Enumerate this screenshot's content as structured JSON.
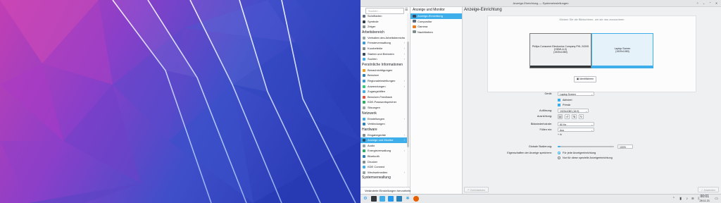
{
  "window": {
    "title": "Anzeige-Einrichtung — Systemeinstellungen",
    "buttons": {
      "help": "?",
      "minimize": "⌄",
      "maximize": "⌃",
      "close": "✕"
    }
  },
  "sidebar": {
    "search_placeholder": "Suchen ...",
    "menu_icon": "hamburger-icon",
    "groups": [
      {
        "items": [
          {
            "label": "Schriftarten",
            "icon_color": "#5d6d7e",
            "chevron": false
          },
          {
            "label": "Symbole",
            "icon_color": "#2c3e50",
            "chevron": false
          },
          {
            "label": "Zeiger",
            "icon_color": "#7f8c8d",
            "chevron": false
          }
        ]
      },
      {
        "heading": "Arbeitsbereich",
        "items": [
          {
            "label": "Verhalten des Arbeitsbereichs",
            "icon_color": "#95a5a6",
            "chevron": true
          },
          {
            "label": "Fensterverwaltung",
            "icon_color": "#3498db",
            "chevron": true
          },
          {
            "label": "Kurzbefehle",
            "icon_color": "#7f8c8d",
            "chevron": true
          },
          {
            "label": "Starten und Beenden",
            "icon_color": "#34495e",
            "chevron": true
          },
          {
            "label": "Suchen",
            "icon_color": "#3daee9",
            "chevron": true
          }
        ]
      },
      {
        "heading": "Persönliche Informationen",
        "items": [
          {
            "label": "Benachrichtigungen",
            "icon_color": "#f39c12",
            "chevron": false
          },
          {
            "label": "Benutzer",
            "icon_color": "#2980b9",
            "chevron": false
          },
          {
            "label": "Regionaleinstellungen",
            "icon_color": "#3498db",
            "chevron": true
          },
          {
            "label": "Anwendungen",
            "icon_color": "#2ecc71",
            "chevron": true
          },
          {
            "label": "Zugangshilfen",
            "icon_color": "#3daee9",
            "chevron": false
          },
          {
            "label": "Benutzer-Feedback",
            "icon_color": "#e74c3c",
            "chevron": false
          },
          {
            "label": "KDE-Passwortspeicher",
            "icon_color": "#27ae60",
            "chevron": false
          },
          {
            "label": "Sitzungen",
            "icon_color": "#95a5a6",
            "chevron": false
          }
        ]
      },
      {
        "heading": "Netzwerk",
        "items": [
          {
            "label": "Einstellungen",
            "icon_color": "#3daee9",
            "chevron": true
          },
          {
            "label": "Verbindungen",
            "icon_color": "#2980b9",
            "chevron": false
          }
        ]
      },
      {
        "heading": "Hardware",
        "items": [
          {
            "label": "Eingabegeräte",
            "icon_color": "#7f8c8d",
            "chevron": true
          },
          {
            "label": "Anzeige und Monitor",
            "icon_color": "#34495e",
            "chevron": true,
            "selected": true
          },
          {
            "label": "Audio",
            "icon_color": "#95a5a6",
            "chevron": false
          },
          {
            "label": "Energieverwaltung",
            "icon_color": "#27ae60",
            "chevron": true
          },
          {
            "label": "Bluetooth",
            "icon_color": "#2980b9",
            "chevron": false
          },
          {
            "label": "Drucker",
            "icon_color": "#7f8c8d",
            "chevron": false
          },
          {
            "label": "KDE Connect",
            "icon_color": "#3daee9",
            "chevron": false
          },
          {
            "label": "Wechselmedien",
            "icon_color": "#95a5a6",
            "chevron": true
          }
        ]
      },
      {
        "heading": "Systemverwaltung",
        "items": []
      }
    ],
    "footer": "Veränderte Einstellungen hervorheben"
  },
  "middle": {
    "header": "Anzeige und Monitor",
    "items": [
      {
        "label": "Anzeige-Einrichtung",
        "icon_color": "#34495e",
        "selected": true
      },
      {
        "label": "Compositor",
        "icon_color": "#5d6d7e"
      },
      {
        "label": "Gamma",
        "icon_color": "#e67e22"
      },
      {
        "label": "Nachtfarben",
        "icon_color": "#7f8c8d"
      }
    ]
  },
  "content": {
    "title": "Anzeige-Einrichtung",
    "hint": "Klicken Sie die Bildschirme, um sie neu anzuordnen",
    "monitors": [
      {
        "name": "Philips Consumer Electronics Company PHL 243V5",
        "connector": "(HDMI-A-0)",
        "mode": "(1920x1080)",
        "selected": false
      },
      {
        "name": "Laptop Screen",
        "connector": "",
        "mode": "(1920x1080)",
        "selected": true
      }
    ],
    "identify_button": "Identifizieren",
    "fields": {
      "device_label": "Gerät:",
      "device_value": "Laptop Screen",
      "enabled_label": "Aktiviert",
      "primary_label": "Primär",
      "resolution_label": "Auflösung:",
      "resolution_value": "1920x1080 (16:9)",
      "orientation_label": "Ausrichtung:",
      "refresh_label": "Bildwiederholrate:",
      "refresh_value": "60 Hz",
      "rgb_label": "Füllen ein:",
      "rgb_value": "Aus",
      "extra": "+ ⊖",
      "scale_label": "Globale Skalierung:",
      "scale_value": "100%",
      "scale_fraction": 0.05,
      "save_label": "Eigenschaften der Anzeige speichern:",
      "radio_all": "Für jede Anzeigeeinrichtung",
      "radio_specific": "Nur für diese spezielle Anzeigeeinrichtung"
    },
    "bottom": {
      "defaults": "Zurücksetzen",
      "apply": "Anwenden"
    }
  },
  "taskbar": {
    "icons": [
      "kde-launcher-icon",
      "pager-icon",
      "systemsettings-icon",
      "files-icon",
      "discover-icon",
      "firefox-icon",
      "konsole-icon"
    ],
    "tray": [
      "network-icon",
      "volume-icon",
      "bluetooth-icon",
      "battery-icon",
      "arrow-up-icon"
    ],
    "time": "00:01",
    "date": "28.11.21"
  }
}
